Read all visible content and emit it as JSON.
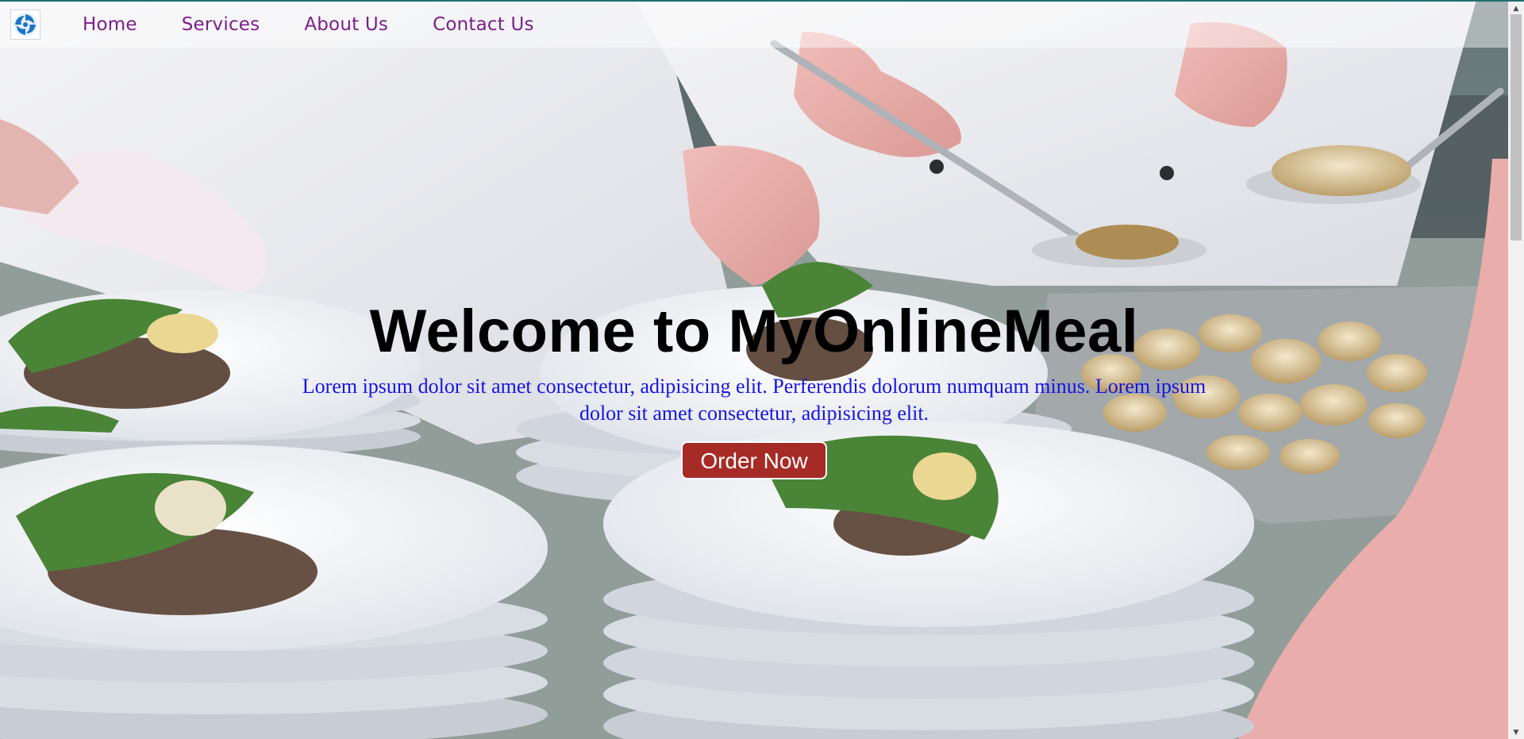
{
  "nav": {
    "logo_icon": "swirl-logo-icon",
    "links": [
      {
        "label": "Home"
      },
      {
        "label": "Services"
      },
      {
        "label": "About Us"
      },
      {
        "label": "Contact Us"
      }
    ],
    "link_color": "#7b1f8a"
  },
  "hero": {
    "title": "Welcome to MyOnlineMeal",
    "subtitle": "Lorem ipsum dolor sit amet consectetur, adipisicing elit. Perferendis dolorum numquam minus. Lorem ipsum dolor sit amet consectetur, adipisicing elit.",
    "subtitle_color": "#1515e6",
    "cta_label": "Order Now",
    "cta_color": "#a62a25",
    "background_description_icon": "chefs-plating-food-photo"
  },
  "scrollbar": {
    "up_icon": "scroll-up-arrow-icon",
    "down_icon": "scroll-down-arrow-icon"
  }
}
